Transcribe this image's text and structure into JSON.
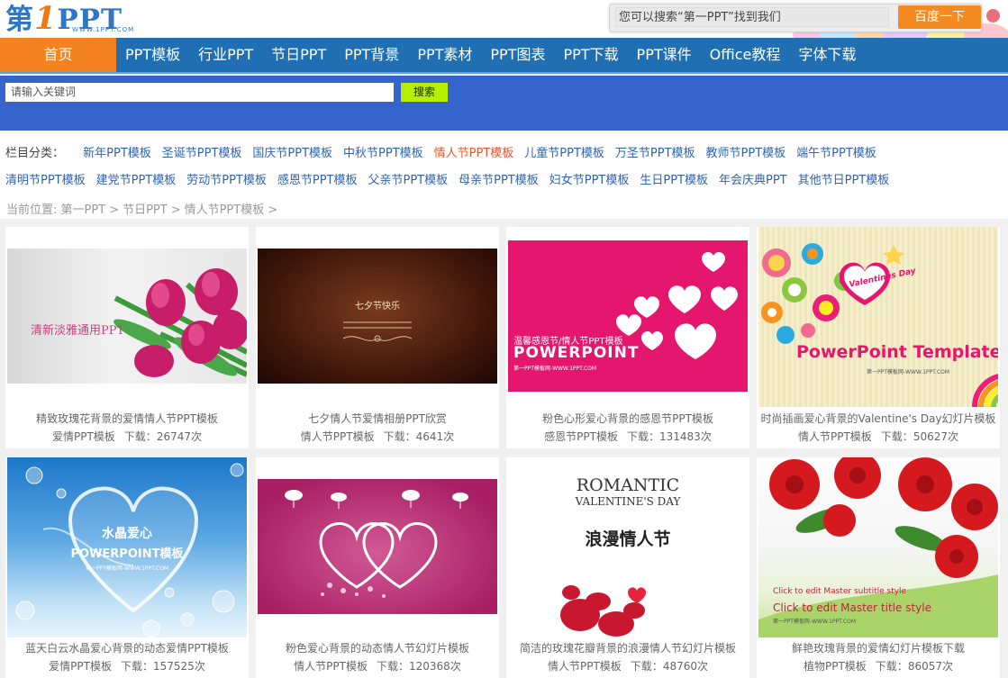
{
  "logo": {
    "text_main": "第",
    "text_one": "1",
    "text_ppt": "PPT",
    "url": "WWW.1PPT.COM"
  },
  "top_search": {
    "placeholder": "您可以搜索“第一PPT”找到我们",
    "button": "百度一下"
  },
  "nav": {
    "home": "首页",
    "items": [
      "PPT模板",
      "行业PPT",
      "节日PPT",
      "PPT背景",
      "PPT素材",
      "PPT图表",
      "PPT下载",
      "PPT课件",
      "Office教程",
      "字体下载"
    ]
  },
  "keyword_search": {
    "placeholder": "请输入关键词",
    "button": "搜索"
  },
  "categories": {
    "label": "栏目分类：",
    "row1": [
      "新年PPT模板",
      "圣诞节PPT模板",
      "国庆节PPT模板",
      "中秋节PPT模板",
      "情人节PPT模板",
      "儿童节PPT模板",
      "万圣节PPT模板",
      "教师节PPT模板",
      "端午节PPT模板"
    ],
    "row2": [
      "清明节PPT模板",
      "建党节PPT模板",
      "劳动节PPT模板",
      "感恩节PPT模板",
      "父亲节PPT模板",
      "母亲节PPT模板",
      "妇女节PPT模板",
      "生日PPT模板",
      "年会庆典PPT",
      "其他节日PPT模板"
    ],
    "active": "情人节PPT模板"
  },
  "breadcrumb": {
    "prefix": "当前位置:",
    "items": [
      "第一PPT",
      "节日PPT",
      "情人节PPT模板"
    ],
    "sep": ">"
  },
  "download_label": "下载：",
  "count_suffix": "次",
  "cards": [
    {
      "title": "精致玫瑰花背景的爱情情人节PPT模板",
      "category": "爱情PPT模板",
      "downloads": "26747",
      "thumb_text": "清新淡雅通用PPT"
    },
    {
      "title": "七夕情人节爱情相册PPT欣赏",
      "category": "情人节PPT模板",
      "downloads": "4641",
      "thumb_text": "七夕节快乐"
    },
    {
      "title": "粉色心形爱心背景的感恩节PPT模板",
      "category": "感恩节PPT模板",
      "downloads": "131483",
      "thumb_text": "温馨感恩节/情人节PPT模板",
      "thumb_text2": "POWERPOINT",
      "thumb_text3": "第一PPT模板网-WWW.1PPT.COM"
    },
    {
      "title": "时尚插画爱心背景的Valentine's Day幻灯片模板",
      "category": "情人节PPT模板",
      "downloads": "50627",
      "thumb_text": "PowerPoint Template",
      "thumb_text2": "Valentines Day",
      "thumb_text3": "第一PPT模板网-WWW.1PPT.COM"
    },
    {
      "title": "蓝天白云水晶爱心背景的动态爱情PPT模板",
      "category": "爱情PPT模板",
      "downloads": "157525",
      "thumb_text": "水晶爱心",
      "thumb_text2": "POWERPOINT模板",
      "thumb_text3": "第一PPT模板网-WWW.1PPT.COM"
    },
    {
      "title": "粉色爱心背景的动态情人节幻灯片模板",
      "category": "情人节PPT模板",
      "downloads": "120368"
    },
    {
      "title": "简洁的玫瑰花瓣背景的浪漫情人节幻灯片模板",
      "category": "情人节PPT模板",
      "downloads": "48760",
      "thumb_text": "ROMANTIC",
      "thumb_text2": "VALENTINE'S DAY",
      "thumb_text3": "浪漫情人节"
    },
    {
      "title": "鲜艳玫瑰背景的爱情幻灯片模板下载",
      "category": "植物PPT模板",
      "downloads": "86057",
      "thumb_text": "Click to edit Master subtitle style",
      "thumb_text2": "Click to edit Master title style",
      "thumb_text3": "第一PPT模板网-WWW.1PPT.COM"
    }
  ]
}
